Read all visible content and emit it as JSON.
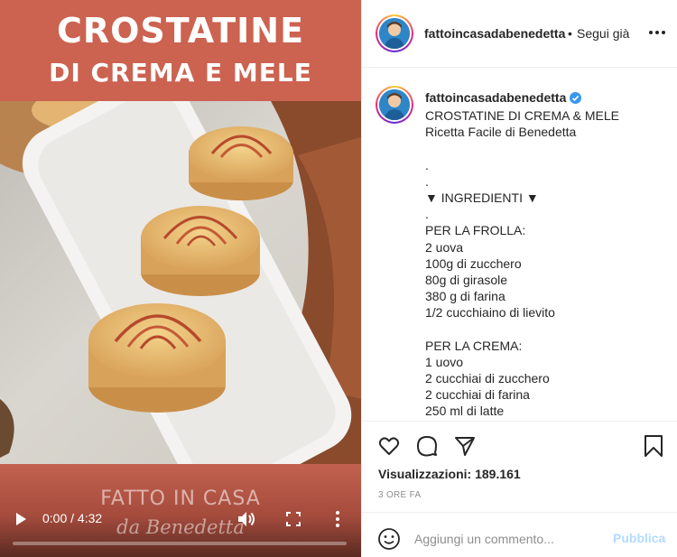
{
  "video": {
    "title_line1": "CROSTATINE",
    "title_line2": "DI CREMA E MELE",
    "brand_line1": "FATTO IN CASA",
    "brand_line2": "da Benedetta",
    "current_time": "0:00",
    "time_separator": " / ",
    "duration": "4:32",
    "progress_fraction": 0.0,
    "icons": [
      "play-icon",
      "volume-icon",
      "fullscreen-icon",
      "more-vertical-icon"
    ]
  },
  "header": {
    "username": "fattoincasadabenedetta",
    "separator": "•",
    "follow_label": "Segui già",
    "more_icon": "more-horizontal-icon"
  },
  "caption": {
    "username": "fattoincasadabenedetta",
    "verified_icon": "verified-badge-icon",
    "lines": [
      "CROSTATINE DI CREMA & MELE",
      "Ricetta Facile di Benedetta",
      "",
      ".",
      ".",
      "▼ INGREDIENTI ▼",
      ".",
      "PER LA FROLLA:",
      "2 uova",
      "100g di zucchero",
      "80g di girasole",
      "380 g di farina",
      "1/2 cucchiaino di lievito",
      "",
      "PER LA CREMA:",
      "1 uovo",
      "2 cucchiai di zucchero",
      "2 cucchiai di farina",
      "250 ml di latte"
    ]
  },
  "actions": {
    "icons": [
      "heart-icon",
      "comment-icon",
      "share-icon",
      "bookmark-icon"
    ],
    "views_label": "Visualizzazioni:",
    "views_count": "189.161",
    "time_ago": "3 ORE FA"
  },
  "comment": {
    "placeholder": "Aggiungi un commento...",
    "post_label": "Pubblica",
    "emoji_icon": "emoji-icon"
  },
  "colors": {
    "title_band": "#cc6250",
    "link_disabled": "#b3dbff",
    "verified": "#3897f0",
    "muted": "#8e8e8e"
  }
}
